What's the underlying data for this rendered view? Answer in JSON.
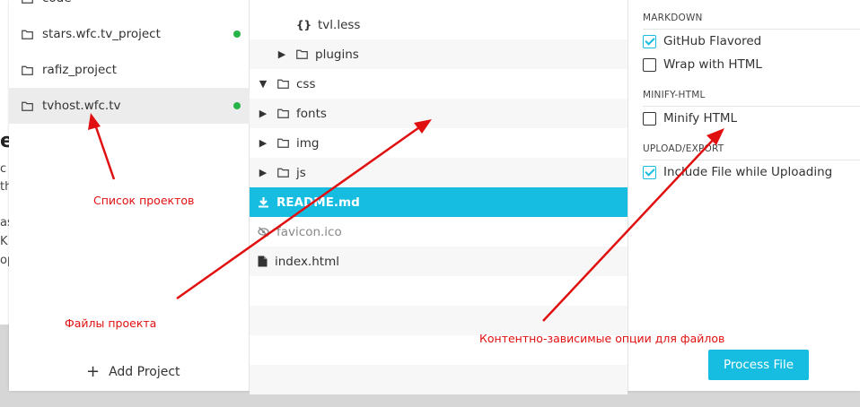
{
  "background": {
    "fragments": [
      "e",
      "c",
      "th",
      "as",
      "K",
      "op"
    ]
  },
  "sidebar": {
    "projects": [
      {
        "label": "code",
        "status_dot": false,
        "active": false
      },
      {
        "label": "stars.wfc.tv_project",
        "status_dot": true,
        "active": false
      },
      {
        "label": "rafiz_project",
        "status_dot": false,
        "active": false
      },
      {
        "label": "tvhost.wfc.tv",
        "status_dot": true,
        "active": true
      }
    ],
    "add_project_label": "Add Project"
  },
  "tree": {
    "rows": [
      {
        "label": "tvl.less",
        "icon": "braces-icon"
      },
      {
        "label": "plugins",
        "icon": "folder-icon",
        "arrow": "collapsed"
      },
      {
        "label": "css",
        "icon": "folder-icon",
        "arrow": "expanded"
      },
      {
        "label": "fonts",
        "icon": "folder-icon",
        "arrow": "collapsed"
      },
      {
        "label": "img",
        "icon": "folder-icon",
        "arrow": "collapsed"
      },
      {
        "label": "js",
        "icon": "folder-icon",
        "arrow": "collapsed"
      },
      {
        "label": "README.md",
        "icon": "download-icon",
        "selected": true
      },
      {
        "label": "favicon.ico",
        "icon": "eye-slash-icon",
        "muted": true
      },
      {
        "label": "index.html",
        "icon": "file-icon"
      }
    ]
  },
  "options": {
    "sections": [
      {
        "title": "MARKDOWN",
        "items": [
          {
            "label": "GitHub Flavored",
            "checked": true
          },
          {
            "label": "Wrap with HTML",
            "checked": false
          }
        ]
      },
      {
        "title": "MINIFY-HTML",
        "items": [
          {
            "label": "Minify HTML",
            "checked": false
          }
        ]
      },
      {
        "title": "UPLOAD/EXPORT",
        "items": [
          {
            "label": "Include File while Uploading",
            "checked": true
          }
        ]
      }
    ],
    "process_button": "Process File"
  },
  "annotations": {
    "projects_list": "Список проектов",
    "project_files": "Файлы проекта",
    "content_options": "Контентно-зависимые опции для файлов"
  },
  "colors": {
    "accent": "#16bde0",
    "status_dot": "#2ab34a",
    "annotation": "#e01010"
  }
}
